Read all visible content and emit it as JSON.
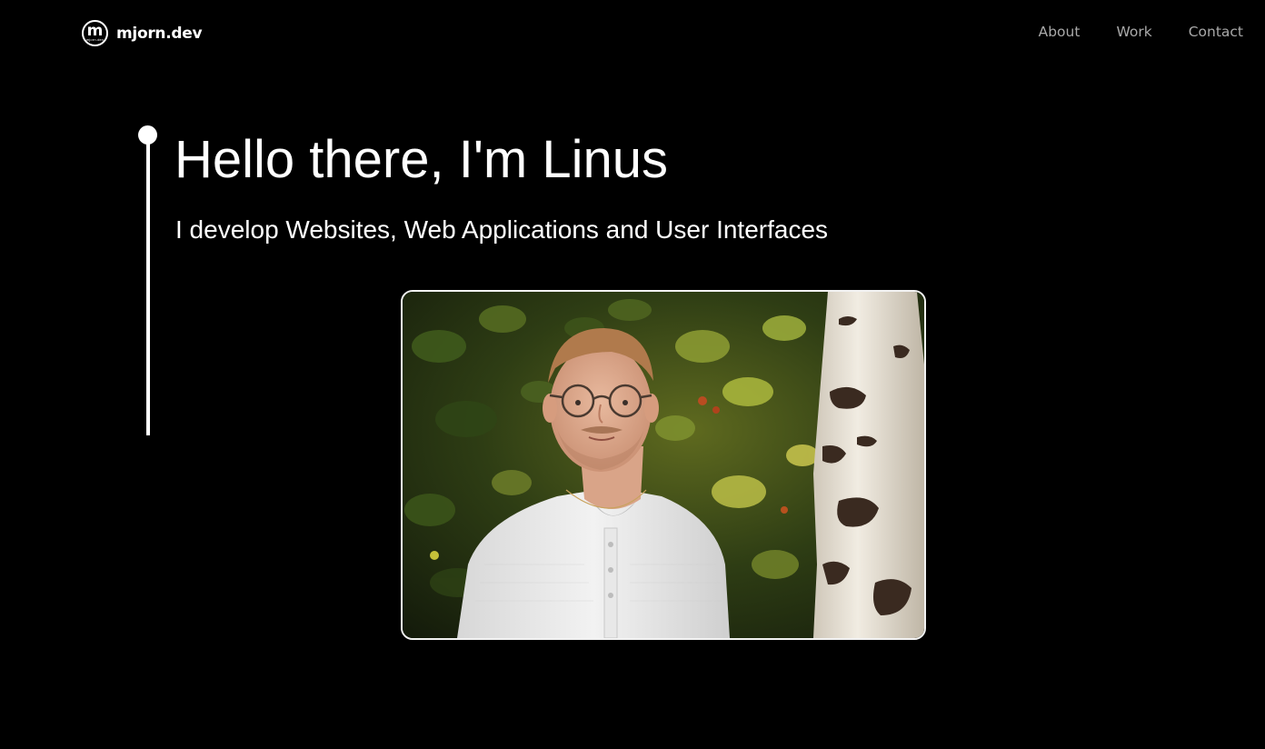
{
  "header": {
    "logo": {
      "letter": "m",
      "sub_text": "mjorn.dev"
    },
    "brand_name": "mjorn.dev",
    "nav": [
      {
        "label": "About"
      },
      {
        "label": "Work"
      },
      {
        "label": "Contact"
      }
    ]
  },
  "hero": {
    "title": "Hello there, I'm Linus",
    "subtitle": "I develop Websites, Web Applications and User Interfaces"
  },
  "portrait": {
    "subject": "portrait photo of a man with glasses in a white henley shirt, standing before green foliage next to a birch tree trunk"
  },
  "colors": {
    "background": "#000000",
    "text": "#ffffff",
    "nav_text": "#a9a9a9"
  }
}
